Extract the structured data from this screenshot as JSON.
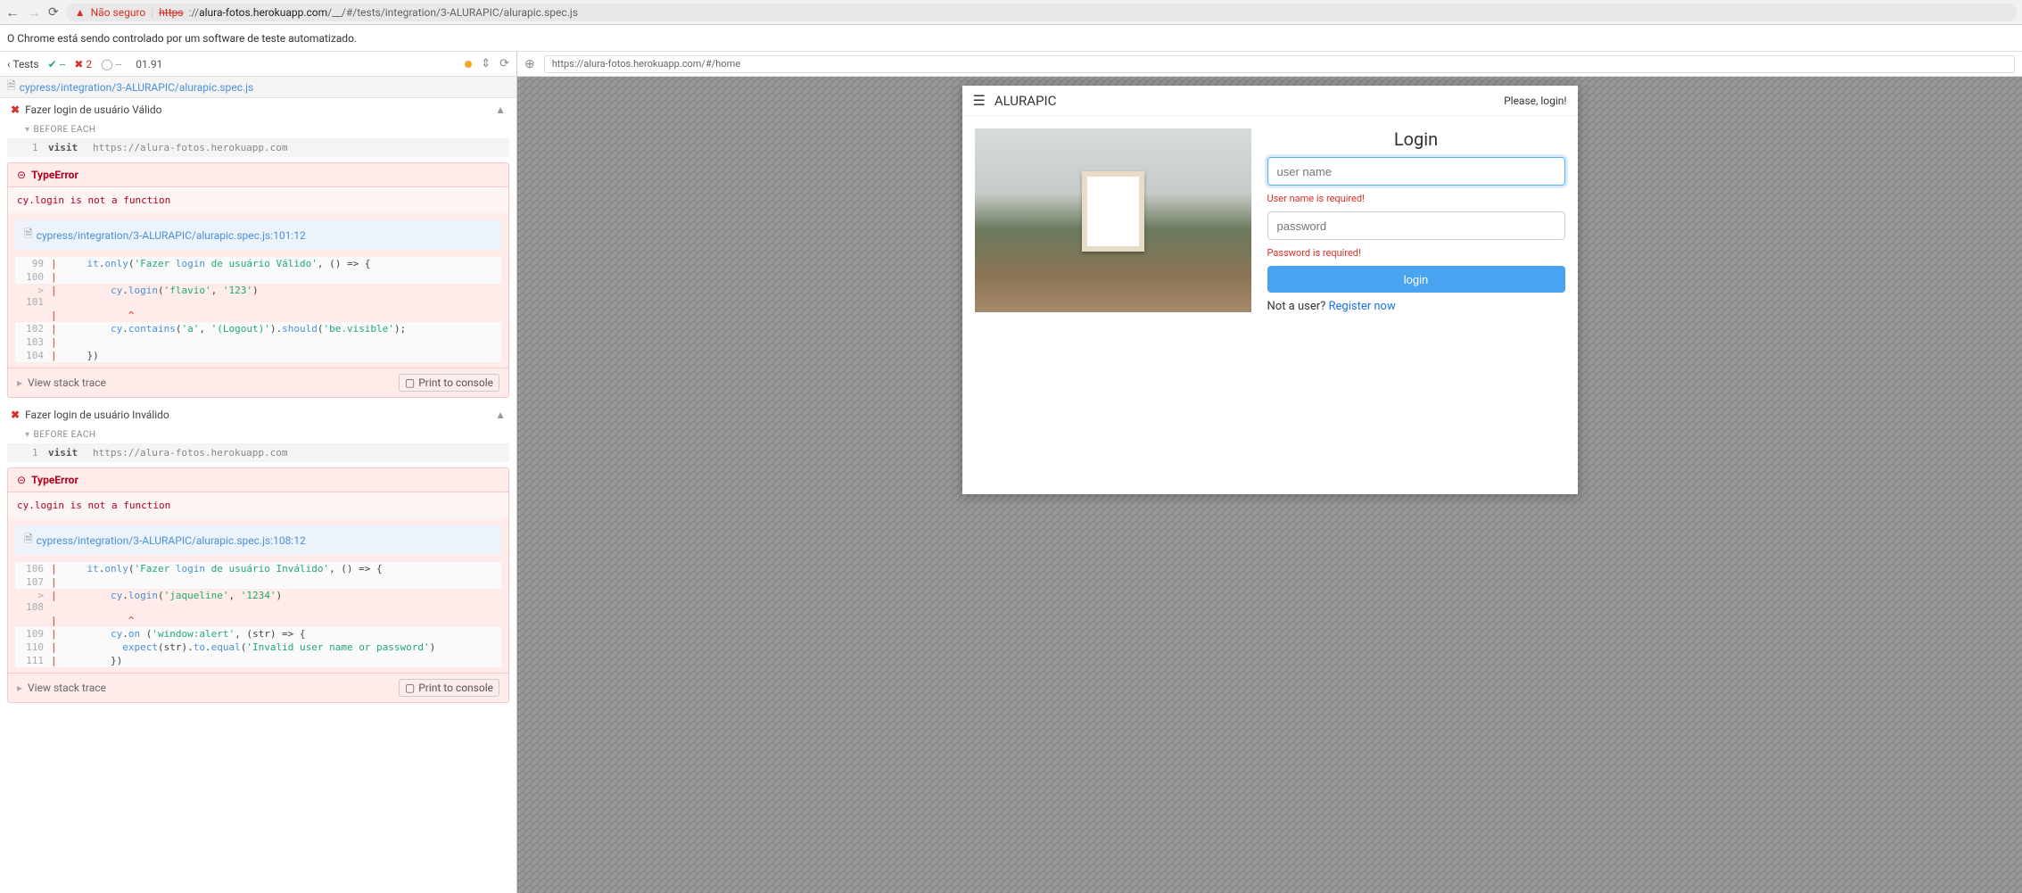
{
  "browser": {
    "not_secure": "Não seguro",
    "url_scheme": "https",
    "url_host": "alura-fotos.herokuapp.com",
    "url_path": "/__/#/tests/integration/3-ALURAPIC/alurapic.spec.js"
  },
  "infobar": "O Chrome está sendo controlado por um software de teste automatizado.",
  "runner": {
    "back": "Tests",
    "pass": "--",
    "fail": "2",
    "pending": "--",
    "time": "01.91",
    "spec_path": "cypress/integration/3-ALURAPIC/alurapic.spec.js"
  },
  "tests": [
    {
      "title": "Fazer login de usuário Válido",
      "hook": "BEFORE EACH",
      "cmd_num": "1",
      "cmd_name": "visit",
      "cmd_msg": "https://alura-fotos.herokuapp.com",
      "err_type": "TypeError",
      "err_msg": "cy.login is not a function",
      "code_head": "cypress/integration/3-ALURAPIC/alurapic.spec.js:101:12",
      "lines": [
        {
          "n": "99",
          "hl": false,
          "g": "|",
          "txt": "    it.only('Fazer login de usuário Válido', () => {"
        },
        {
          "n": "100",
          "hl": false,
          "g": "|",
          "txt": ""
        },
        {
          "n": "101",
          "hl": true,
          "g": "|",
          "pre": "> ",
          "txt": "        cy.login('flavio', '123')"
        },
        {
          "n": "",
          "hl": true,
          "g": "|",
          "txt": "           ^",
          "caret": true
        },
        {
          "n": "102",
          "hl": false,
          "g": "|",
          "txt": "        cy.contains('a', '(Logout)').should('be.visible');"
        },
        {
          "n": "103",
          "hl": false,
          "g": "|",
          "txt": ""
        },
        {
          "n": "104",
          "hl": false,
          "g": "|",
          "txt": "    })"
        }
      ],
      "stack": "View stack trace",
      "print": "Print to console"
    },
    {
      "title": "Fazer login de usuário Inválido",
      "hook": "BEFORE EACH",
      "cmd_num": "1",
      "cmd_name": "visit",
      "cmd_msg": "https://alura-fotos.herokuapp.com",
      "err_type": "TypeError",
      "err_msg": "cy.login is not a function",
      "code_head": "cypress/integration/3-ALURAPIC/alurapic.spec.js:108:12",
      "lines": [
        {
          "n": "106",
          "hl": false,
          "g": "|",
          "txt": "    it.only('Fazer login de usuário Inválido', () => {"
        },
        {
          "n": "107",
          "hl": false,
          "g": "|",
          "txt": ""
        },
        {
          "n": "108",
          "hl": true,
          "g": "|",
          "pre": "> ",
          "txt": "        cy.login('jaqueline', '1234')"
        },
        {
          "n": "",
          "hl": true,
          "g": "|",
          "txt": "           ^",
          "caret": true
        },
        {
          "n": "109",
          "hl": false,
          "g": "|",
          "txt": "        cy.on ('window:alert', (str) => {"
        },
        {
          "n": "110",
          "hl": false,
          "g": "|",
          "txt": "          expect(str).to.equal('Invalid user name or password')"
        },
        {
          "n": "111",
          "hl": false,
          "g": "|",
          "txt": "        })"
        }
      ],
      "stack": "View stack trace",
      "print": "Print to console"
    }
  ],
  "aut": {
    "url": "https://alura-fotos.herokuapp.com/#/home",
    "brand": "ALURAPIC",
    "please": "Please, login!",
    "login_title": "Login",
    "user_ph": "user name",
    "user_err": "User name is required!",
    "pass_ph": "password",
    "pass_err": "Password is required!",
    "login_btn": "login",
    "not_user": "Not a user? ",
    "register": "Register now"
  }
}
